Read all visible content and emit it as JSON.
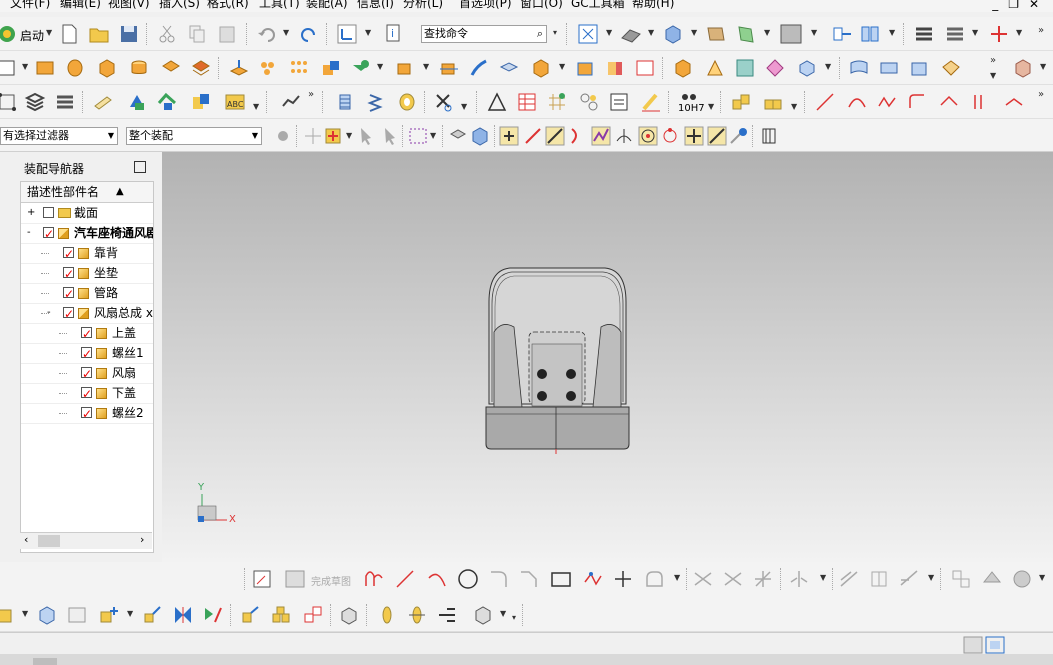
{
  "menu": [
    "文件(F)",
    "编辑(E)",
    "视图(V)",
    "插入(S)",
    "格式(R)",
    "工具(T)",
    "装配(A)",
    "信息(I)",
    "分析(L)",
    "首选项(P)",
    "窗口(O)",
    "GC工具箱",
    "帮助(H)"
  ],
  "toolbar": {
    "start_label": "启动",
    "search_placeholder": "查找命令",
    "tolerance_label": "10H7"
  },
  "selection": {
    "filter": "有选择过滤器",
    "scope": "整个装配"
  },
  "navigator": {
    "title": "装配导航器",
    "column_header": "描述性部件名",
    "items": [
      {
        "label": "截面",
        "checked": false,
        "level": 0,
        "kind": "folder",
        "expand": "+"
      },
      {
        "label": "汽车座椅通风剧",
        "checked": true,
        "level": 0,
        "kind": "assembly",
        "expand": "-",
        "bold": true
      },
      {
        "label": "靠背",
        "checked": true,
        "level": 1,
        "kind": "part"
      },
      {
        "label": "坐垫",
        "checked": true,
        "level": 1,
        "kind": "part"
      },
      {
        "label": "管路",
        "checked": true,
        "level": 1,
        "kind": "part"
      },
      {
        "label": "风扇总成 x",
        "checked": true,
        "level": 1,
        "kind": "assembly",
        "expand": "-"
      },
      {
        "label": "上盖",
        "checked": true,
        "level": 2,
        "kind": "part"
      },
      {
        "label": "螺丝1",
        "checked": true,
        "level": 2,
        "kind": "part"
      },
      {
        "label": "风扇",
        "checked": true,
        "level": 2,
        "kind": "part"
      },
      {
        "label": "下盖",
        "checked": true,
        "level": 2,
        "kind": "part"
      },
      {
        "label": "螺丝2",
        "checked": true,
        "level": 2,
        "kind": "part"
      }
    ]
  },
  "viewport": {
    "axis_y": "Y",
    "axis_x": "X"
  },
  "sketch_toolbar": {
    "finish_sketch": "完成草图"
  },
  "colors": {
    "accent": "#2a6fc9",
    "check": "#e00000",
    "part": "#e8b030"
  }
}
